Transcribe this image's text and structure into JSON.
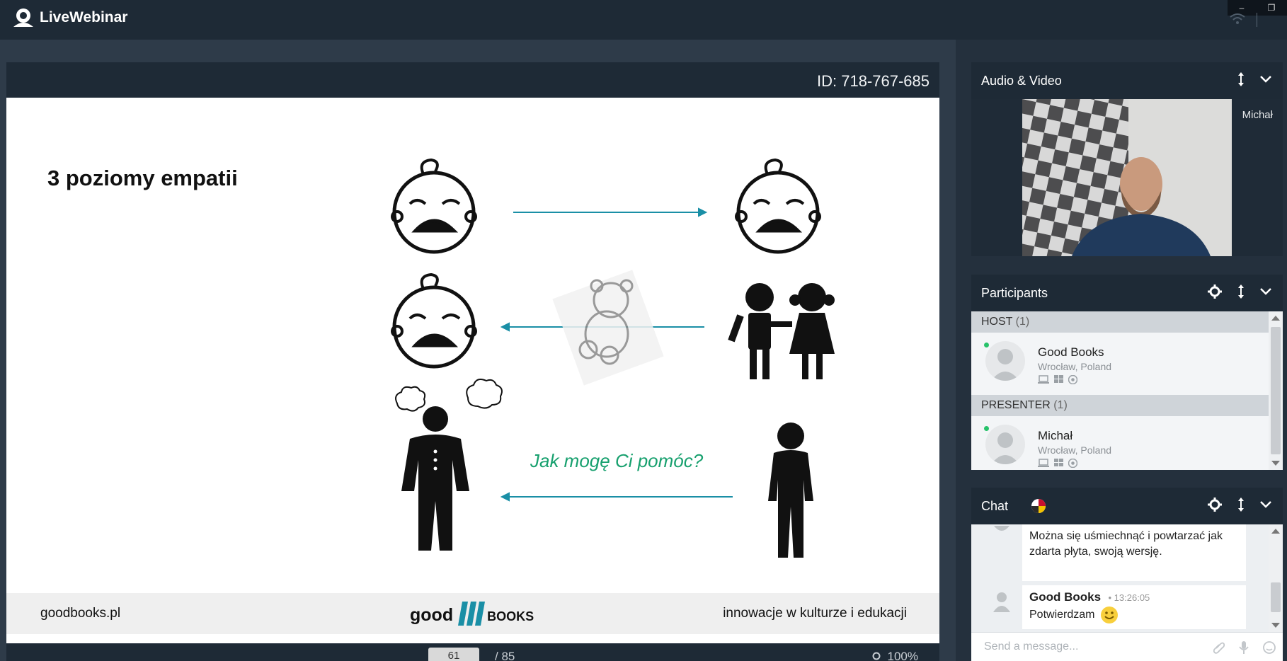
{
  "app": {
    "name": "LiveWebinar",
    "window_controls": [
      "–",
      "❐"
    ]
  },
  "stage": {
    "session_id": "ID: 718-767-685",
    "slide": {
      "title": "3 poziomy empatii",
      "quote": "Jak mogę Ci pomóc?",
      "footer_left": "goodbooks.pl",
      "footer_logo_left": "good",
      "footer_logo_right": "books",
      "footer_right": "innowacje w kulturze i edukacji"
    },
    "pager": {
      "current_page": "61",
      "total": "/ 85",
      "zoom": "100%"
    }
  },
  "audio_video": {
    "title": "Audio & Video",
    "presenter_name": "Michał"
  },
  "participants": {
    "title": "Participants",
    "groups": [
      {
        "label": "HOST",
        "count": "(1)",
        "members": [
          {
            "name": "Good Books",
            "location": "Wrocław, Poland"
          }
        ]
      },
      {
        "label": "PRESENTER",
        "count": "(1)",
        "members": [
          {
            "name": "Michał",
            "location": "Wrocław, Poland"
          }
        ]
      }
    ]
  },
  "chat": {
    "title": "Chat",
    "messages": [
      {
        "text": "Można się uśmiechnąć i powtarzać jak zdarta płyta, swoją wersję."
      },
      {
        "author": "Good Books",
        "time": "• 13:26:05",
        "text": "Potwierdzam"
      }
    ],
    "input_placeholder": "Send a message..."
  },
  "colors": {
    "topbar": "#1e2a36",
    "accent_arrow": "#1a8fa6",
    "quote_green": "#17a06e",
    "online": "#27c26a"
  }
}
